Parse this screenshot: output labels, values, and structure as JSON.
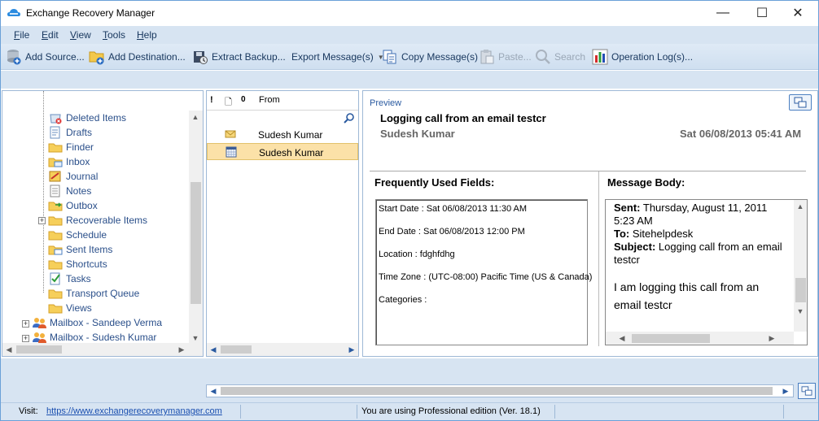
{
  "window": {
    "title": "Exchange Recovery Manager",
    "controls": {
      "minimize": "—",
      "maximize": "☐",
      "close": "✕"
    }
  },
  "menu": {
    "items": [
      {
        "first": "F",
        "rest": "ile"
      },
      {
        "first": "E",
        "rest": "dit"
      },
      {
        "first": "V",
        "rest": "iew"
      },
      {
        "first": "T",
        "rest": "ools"
      },
      {
        "first": "H",
        "rest": "elp"
      }
    ]
  },
  "toolbar": {
    "add_source": "Add Source...",
    "add_destination": "Add Destination...",
    "extract_backup": "Extract Backup...",
    "export_message": "Export Message(s)",
    "copy_message": "Copy Message(s)",
    "paste": "Paste...",
    "search": "Search",
    "operation_logs": "Operation Log(s)..."
  },
  "tree": {
    "folders": [
      {
        "label": "Deleted Items",
        "icon": "deleted-items-icon"
      },
      {
        "label": "Drafts",
        "icon": "drafts-icon"
      },
      {
        "label": "Finder",
        "icon": "folder-icon"
      },
      {
        "label": "Inbox",
        "icon": "inbox-icon"
      },
      {
        "label": "Journal",
        "icon": "journal-icon"
      },
      {
        "label": "Notes",
        "icon": "notes-icon"
      },
      {
        "label": "Outbox",
        "icon": "outbox-icon"
      },
      {
        "label": "Recoverable Items",
        "icon": "folder-icon",
        "expandable": true
      },
      {
        "label": "Schedule",
        "icon": "folder-icon"
      },
      {
        "label": "Sent Items",
        "icon": "sent-items-icon"
      },
      {
        "label": "Shortcuts",
        "icon": "folder-icon"
      },
      {
        "label": "Tasks",
        "icon": "tasks-icon"
      },
      {
        "label": "Transport Queue",
        "icon": "folder-icon"
      },
      {
        "label": "Views",
        "icon": "folder-icon"
      }
    ],
    "mailboxes": [
      {
        "label": "Mailbox - Sandeep  Verma"
      },
      {
        "label": "Mailbox - Sudesh Kumar"
      }
    ]
  },
  "message_list": {
    "columns": {
      "importance": "!",
      "type": "🗋",
      "attachment": "0",
      "from": "From"
    },
    "rows": [
      {
        "from": "Sudesh Kumar",
        "icon": "envelope-icon",
        "selected": false
      },
      {
        "from": "Sudesh Kumar",
        "icon": "calendar-icon",
        "selected": true
      }
    ]
  },
  "preview": {
    "label": "Preview",
    "subject": "Logging call from an email testcr",
    "sender": "Sudesh Kumar",
    "date": "Sat 06/08/2013 05:41 AM",
    "fields_title": "Frequently Used Fields:",
    "fields": [
      "Start Date : Sat 06/08/2013 11:30 AM",
      "End Date : Sat 06/08/2013 12:00 PM",
      "Location : fdghfdhg",
      "Time Zone : (UTC-08:00) Pacific Time (US & Canada)",
      "Categories :"
    ],
    "body_title": "Message Body:",
    "body": {
      "sent_label": "Sent:",
      "sent_value": " Thursday, August 11, 2011 5:23 AM",
      "to_label": "To:",
      "to_value": " Sitehelpdesk",
      "subject_label": "Subject:",
      "subject_value": " Logging call from an email testcr",
      "message": "I am logging this call from an email testcr"
    }
  },
  "status": {
    "visit_label": "Visit:",
    "link": "https://www.exchangerecoverymanager.com",
    "edition": "You are using Professional edition (Ver. 18.1)"
  }
}
